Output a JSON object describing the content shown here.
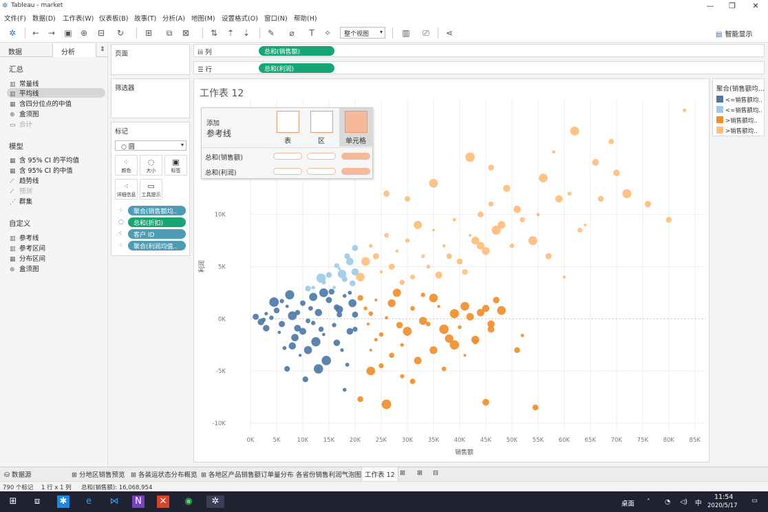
{
  "window": {
    "title": "Tableau - market",
    "minimize": "—",
    "restore": "❐",
    "close": "✕"
  },
  "menu": [
    "文件(F)",
    "数据(D)",
    "工作表(W)",
    "仪表板(B)",
    "故事(T)",
    "分析(A)",
    "地图(M)",
    "设置格式(O)",
    "窗口(N)",
    "帮助(H)"
  ],
  "toolbar": {
    "view_select": "整个视图",
    "smart_display": "智能显示"
  },
  "left": {
    "tabs": [
      "数据",
      "分析"
    ],
    "summary_title": "汇总",
    "summary_items": [
      {
        "label": "常量线",
        "icon": "bar-chart-icon",
        "state": "normal"
      },
      {
        "label": "平均线",
        "icon": "bar-chart-icon",
        "state": "selected"
      },
      {
        "label": "含四分位点的中值",
        "icon": "grid-icon",
        "state": "normal"
      },
      {
        "label": "盒须图",
        "icon": "boxplot-icon",
        "state": "normal"
      },
      {
        "label": "合计",
        "icon": "sum-icon",
        "state": "disabled"
      }
    ],
    "model_title": "模型",
    "model_items": [
      {
        "label": "含 95% CI 的平均值",
        "icon": "grid-icon",
        "state": "normal"
      },
      {
        "label": "含 95% CI 的中值",
        "icon": "grid-icon",
        "state": "normal"
      },
      {
        "label": "趋势线",
        "icon": "trend-icon",
        "state": "normal"
      },
      {
        "label": "预测",
        "icon": "forecast-icon",
        "state": "disabled"
      },
      {
        "label": "群集",
        "icon": "cluster-icon",
        "state": "normal"
      }
    ],
    "custom_title": "自定义",
    "custom_items": [
      {
        "label": "参考线",
        "icon": "bar-chart-icon"
      },
      {
        "label": "参考区间",
        "icon": "band-icon"
      },
      {
        "label": "分布区间",
        "icon": "grid-icon"
      },
      {
        "label": "盒须图",
        "icon": "boxplot-icon"
      }
    ]
  },
  "shelves": {
    "pages": "页面",
    "filters": "筛选器",
    "marks": "标记",
    "mark_type": "圆",
    "mark_buttons": [
      "颜色",
      "大小",
      "标签",
      "详细信息",
      "工具提示"
    ],
    "mark_pills": [
      "聚合(销售额均..",
      "总和(折扣)",
      "客户 ID",
      "聚合(利润均值.."
    ],
    "columns_label": "列",
    "rows_label": "行",
    "columns_pill": "总和(销售额)",
    "rows_pill": "总和(利润)"
  },
  "sheet": {
    "title": "工作表 12"
  },
  "refline_popup": {
    "add": "添加",
    "title": "参考线",
    "options": [
      "表",
      "区",
      "单元格"
    ],
    "active_option": "单元格",
    "rows": [
      "总和(销售额)",
      "总和(利润)"
    ]
  },
  "legend": {
    "title": "聚合(销售额均...",
    "items": [
      {
        "label": "<=销售额均..",
        "color": "#4e79a7"
      },
      {
        "label": "<=销售额均..",
        "color": "#a0cbe8"
      },
      {
        "label": ">销售额均..",
        "color": "#f28e2b"
      },
      {
        "label": ">销售额均..",
        "color": "#ffbe7d"
      }
    ]
  },
  "chart_data": {
    "type": "scatter",
    "xlabel": "销售额",
    "ylabel": "利润",
    "xlim": [
      0,
      87000
    ],
    "ylim": [
      -11000,
      21000
    ],
    "x_ticks": [
      0,
      5000,
      10000,
      15000,
      20000,
      25000,
      30000,
      35000,
      40000,
      45000,
      50000,
      55000,
      60000,
      65000,
      70000,
      75000,
      80000,
      85000
    ],
    "x_tick_labels": [
      "0K",
      "5K",
      "10K",
      "15K",
      "20K",
      "25K",
      "30K",
      "35K",
      "40K",
      "45K",
      "50K",
      "55K",
      "60K",
      "65K",
      "70K",
      "75K",
      "80K",
      "85K"
    ],
    "y_ticks": [
      -10000,
      -5000,
      0,
      5000,
      10000
    ],
    "y_tick_labels": [
      "-10K",
      "-5K",
      "0K",
      "5K",
      "10K"
    ],
    "grid": true,
    "series": [
      {
        "name": "<=销售额均..",
        "color": "#4e79a7",
        "points": [
          [
            1000,
            200
          ],
          [
            2000,
            -300
          ],
          [
            3000,
            500
          ],
          [
            4000,
            100
          ],
          [
            5000,
            800
          ],
          [
            6000,
            -500
          ],
          [
            7000,
            1200
          ],
          [
            8000,
            300
          ],
          [
            9000,
            -900
          ],
          [
            10000,
            1500
          ],
          [
            11000,
            -200
          ],
          [
            12000,
            2100
          ],
          [
            13000,
            600
          ],
          [
            14000,
            -1500
          ],
          [
            15000,
            1800
          ],
          [
            16000,
            -600
          ],
          [
            17000,
            900
          ],
          [
            18000,
            2200
          ],
          [
            19000,
            -1200
          ],
          [
            20000,
            400
          ],
          [
            6500,
            -2800
          ],
          [
            9500,
            -3500
          ],
          [
            12500,
            -2200
          ],
          [
            14500,
            -4000
          ],
          [
            17500,
            -3000
          ],
          [
            10500,
            -5800
          ],
          [
            13000,
            -4800
          ],
          [
            18500,
            -4400
          ],
          [
            7000,
            -4800
          ],
          [
            3000,
            -900
          ],
          [
            8500,
            -1800
          ],
          [
            11500,
            1000
          ],
          [
            19000,
            2500
          ],
          [
            4500,
            1600
          ],
          [
            15500,
            2600
          ],
          [
            6000,
            1700
          ],
          [
            16500,
            -2300
          ],
          [
            20000,
            -1000
          ],
          [
            18000,
            -6800
          ],
          [
            11000,
            -3000
          ],
          [
            13500,
            -1000
          ],
          [
            9000,
            600
          ],
          [
            5500,
            -1300
          ],
          [
            7500,
            2300
          ],
          [
            12000,
            -400
          ],
          [
            14000,
            2500
          ],
          [
            16500,
            1100
          ],
          [
            2500,
            -100
          ],
          [
            10000,
            -1200
          ],
          [
            17000,
            400
          ],
          [
            19500,
            1500
          ],
          [
            8000,
            -2600
          ]
        ]
      },
      {
        "name": "<=销售额均..",
        "color": "#a0cbe8",
        "points": [
          [
            12000,
            3000
          ],
          [
            14000,
            3500
          ],
          [
            15000,
            4200
          ],
          [
            16000,
            3000
          ],
          [
            17000,
            4800
          ],
          [
            18000,
            3800
          ],
          [
            19000,
            5500
          ],
          [
            20000,
            4500
          ],
          [
            13500,
            3900
          ],
          [
            16500,
            5100
          ],
          [
            18500,
            6000
          ],
          [
            20000,
            6800
          ],
          [
            11000,
            2900
          ],
          [
            17500,
            4300
          ],
          [
            19500,
            3400
          ]
        ]
      },
      {
        "name": ">销售额均..",
        "color": "#f28e2b",
        "points": [
          [
            21000,
            2000
          ],
          [
            23000,
            500
          ],
          [
            25000,
            -1500
          ],
          [
            27000,
            1500
          ],
          [
            29000,
            -2500
          ],
          [
            31000,
            1000
          ],
          [
            33000,
            -200
          ],
          [
            35000,
            2000
          ],
          [
            37000,
            -1000
          ],
          [
            39000,
            500
          ],
          [
            41000,
            1200
          ],
          [
            43000,
            -2000
          ],
          [
            45000,
            1000
          ],
          [
            47000,
            1800
          ],
          [
            23000,
            -3000
          ],
          [
            25000,
            -4500
          ],
          [
            27000,
            -3500
          ],
          [
            29000,
            -5500
          ],
          [
            31000,
            -6000
          ],
          [
            32000,
            -4000
          ],
          [
            35000,
            -3000
          ],
          [
            37000,
            -4800
          ],
          [
            39000,
            -2500
          ],
          [
            41000,
            -3500
          ],
          [
            43000,
            -2200
          ],
          [
            46000,
            -1000
          ],
          [
            51000,
            -3000
          ],
          [
            52000,
            -1600
          ],
          [
            26000,
            -8200
          ],
          [
            21000,
            -7700
          ],
          [
            23000,
            -5000
          ],
          [
            45000,
            -8000
          ],
          [
            54500,
            -8500
          ],
          [
            24000,
            -2000
          ],
          [
            28000,
            2500
          ],
          [
            30000,
            -1200
          ],
          [
            34000,
            -500
          ],
          [
            36000,
            1200
          ],
          [
            40000,
            -800
          ],
          [
            42000,
            200
          ],
          [
            44000,
            600
          ],
          [
            46000,
            -500
          ],
          [
            48000,
            800
          ],
          [
            33000,
            2300
          ],
          [
            38000,
            -1900
          ],
          [
            22000,
            1000
          ],
          [
            22500,
            -500
          ],
          [
            26000,
            100
          ],
          [
            24000,
            1800
          ],
          [
            28500,
            -600
          ]
        ]
      },
      {
        "name": ">销售额均..",
        "color": "#ffbe7d",
        "points": [
          [
            21000,
            4000
          ],
          [
            22000,
            5500
          ],
          [
            23000,
            7000
          ],
          [
            24000,
            6000
          ],
          [
            25000,
            4500
          ],
          [
            26000,
            8000
          ],
          [
            27000,
            5000
          ],
          [
            28000,
            6500
          ],
          [
            29000,
            3500
          ],
          [
            30000,
            7500
          ],
          [
            31000,
            4000
          ],
          [
            32000,
            9000
          ],
          [
            33000,
            6000
          ],
          [
            34000,
            5000
          ],
          [
            35000,
            8500
          ],
          [
            36000,
            4200
          ],
          [
            37000,
            7000
          ],
          [
            38000,
            6000
          ],
          [
            39000,
            9500
          ],
          [
            40000,
            5500
          ],
          [
            41000,
            4500
          ],
          [
            42000,
            8000
          ],
          [
            43000,
            7500
          ],
          [
            44000,
            10000
          ],
          [
            45000,
            6500
          ],
          [
            46000,
            11000
          ],
          [
            47000,
            8500
          ],
          [
            48000,
            9000
          ],
          [
            49000,
            12500
          ],
          [
            50000,
            7000
          ],
          [
            52000,
            9500
          ],
          [
            55000,
            10000
          ],
          [
            56000,
            13500
          ],
          [
            58000,
            16000
          ],
          [
            60000,
            4000
          ],
          [
            61000,
            12000
          ],
          [
            63000,
            8500
          ],
          [
            64000,
            9000
          ],
          [
            66000,
            15000
          ],
          [
            67000,
            11500
          ],
          [
            69000,
            17000
          ],
          [
            70000,
            14000
          ],
          [
            72000,
            12000
          ],
          [
            76000,
            11000
          ],
          [
            80000,
            9500
          ],
          [
            83000,
            20000
          ],
          [
            62000,
            18000
          ],
          [
            59000,
            11500
          ],
          [
            57000,
            6000
          ],
          [
            54000,
            7500
          ],
          [
            51000,
            10500
          ],
          [
            46000,
            14500
          ],
          [
            42000,
            15500
          ],
          [
            35000,
            13000
          ],
          [
            30000,
            11500
          ],
          [
            26000,
            12000
          ],
          [
            44000,
            7000
          ]
        ]
      }
    ]
  },
  "status": {
    "marks": "790 个标记",
    "rows_cols": "1 行 x 1 列",
    "sum": "总和(销售额): 16,068,954"
  },
  "sheet_tabs": [
    "数据源",
    "分地区销售预览",
    "各装运状态分布概览",
    "各地区产品销售额订单量分布",
    "各省份销售利润气泡图",
    "工作表 12"
  ],
  "taskbar": {
    "desktop": "桌面",
    "ime": "中",
    "time": "11:54",
    "date": "2020/5/17"
  }
}
